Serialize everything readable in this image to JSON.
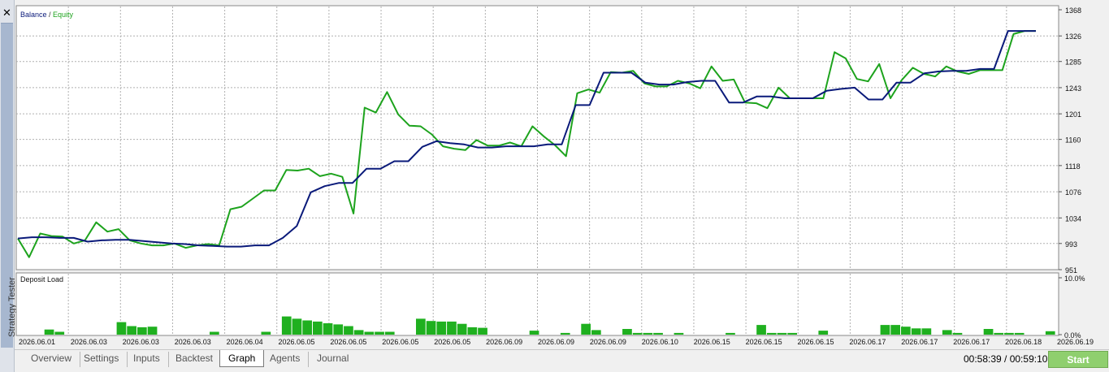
{
  "side_panel": {
    "label": "Strategy Tester",
    "close_glyph": "✕"
  },
  "legend": {
    "balance": "Balance",
    "separator": " / ",
    "equity": "Equity"
  },
  "deposit_label": "Deposit Load",
  "colors": {
    "balance": "#0a1a7a",
    "equity": "#1da31d",
    "bars": "#1fb01f",
    "grid": "#b0b0b0"
  },
  "chart_data": [
    {
      "type": "line",
      "series": [
        {
          "name": "Balance",
          "values": [
            1001,
            1003,
            1003,
            1002,
            1002,
            996,
            998,
            999,
            999,
            997,
            995,
            993,
            992,
            990,
            989,
            988,
            988,
            990,
            990,
            1002,
            1021,
            1075,
            1085,
            1090,
            1090,
            1113,
            1113,
            1125,
            1125,
            1148,
            1157,
            1154,
            1152,
            1147,
            1147,
            1149,
            1149,
            1149,
            1152,
            1152,
            1215,
            1215,
            1267,
            1267,
            1267,
            1251,
            1248,
            1248,
            1252,
            1254,
            1254,
            1219,
            1219,
            1229,
            1229,
            1226,
            1226,
            1226,
            1238,
            1241,
            1243,
            1224,
            1224,
            1251,
            1251,
            1266,
            1269,
            1270,
            1270,
            1273,
            1273,
            1334,
            1334,
            1334
          ]
        },
        {
          "name": "Equity",
          "values": [
            1001,
            971,
            1009,
            1005,
            1004,
            993,
            998,
            1027,
            1012,
            1016,
            998,
            993,
            990,
            990,
            993,
            986,
            990,
            992,
            990,
            1048,
            1052,
            1065,
            1078,
            1078,
            1111,
            1110,
            1113,
            1101,
            1105,
            1100,
            1041,
            1211,
            1203,
            1236,
            1200,
            1182,
            1181,
            1168,
            1149,
            1145,
            1143,
            1159,
            1150,
            1150,
            1155,
            1149,
            1181,
            1165,
            1151,
            1133,
            1234,
            1240,
            1235,
            1268,
            1267,
            1270,
            1250,
            1245,
            1245,
            1254,
            1250,
            1242,
            1277,
            1254,
            1256,
            1219,
            1218,
            1210,
            1243,
            1226,
            1226,
            1226,
            1226,
            1300,
            1290,
            1257,
            1253,
            1281,
            1226,
            1255,
            1275,
            1265,
            1261,
            1277,
            1269,
            1265,
            1271,
            1271,
            1271,
            1329,
            1334,
            1334
          ]
        }
      ],
      "ylim": [
        951,
        1368
      ],
      "y_ticks": [
        "1368",
        "1326",
        "1285",
        "1243",
        "1201",
        "1160",
        "1118",
        "1076",
        "1034",
        "993",
        "951"
      ]
    },
    {
      "type": "bar",
      "title": "Deposit Load",
      "ylim": [
        0,
        10
      ],
      "y_ticks": [
        "10.0%",
        "0.0%"
      ],
      "bars": [
        {
          "slot": 2,
          "v": 0.9
        },
        {
          "slot": 3,
          "v": 0.5
        },
        {
          "slot": 9,
          "v": 2.2
        },
        {
          "slot": 10,
          "v": 1.5
        },
        {
          "slot": 11,
          "v": 1.3
        },
        {
          "slot": 12,
          "v": 1.4
        },
        {
          "slot": 18,
          "v": 0.5
        },
        {
          "slot": 23,
          "v": 0.5
        },
        {
          "slot": 25,
          "v": 3.2
        },
        {
          "slot": 26,
          "v": 2.8
        },
        {
          "slot": 27,
          "v": 2.5
        },
        {
          "slot": 28,
          "v": 2.3
        },
        {
          "slot": 29,
          "v": 2.0
        },
        {
          "slot": 30,
          "v": 1.8
        },
        {
          "slot": 31,
          "v": 1.5
        },
        {
          "slot": 32,
          "v": 0.8
        },
        {
          "slot": 33,
          "v": 0.5
        },
        {
          "slot": 34,
          "v": 0.5
        },
        {
          "slot": 35,
          "v": 0.5
        },
        {
          "slot": 38,
          "v": 2.8
        },
        {
          "slot": 39,
          "v": 2.4
        },
        {
          "slot": 40,
          "v": 2.3
        },
        {
          "slot": 41,
          "v": 2.3
        },
        {
          "slot": 42,
          "v": 1.9
        },
        {
          "slot": 43,
          "v": 1.3
        },
        {
          "slot": 44,
          "v": 1.2
        },
        {
          "slot": 49,
          "v": 0.7
        },
        {
          "slot": 52,
          "v": 0.3
        },
        {
          "slot": 54,
          "v": 1.9
        },
        {
          "slot": 55,
          "v": 0.8
        },
        {
          "slot": 58,
          "v": 1.0
        },
        {
          "slot": 59,
          "v": 0.3
        },
        {
          "slot": 60,
          "v": 0.3
        },
        {
          "slot": 61,
          "v": 0.3
        },
        {
          "slot": 63,
          "v": 0.3
        },
        {
          "slot": 68,
          "v": 0.3
        },
        {
          "slot": 71,
          "v": 1.7
        },
        {
          "slot": 72,
          "v": 0.3
        },
        {
          "slot": 73,
          "v": 0.3
        },
        {
          "slot": 74,
          "v": 0.3
        },
        {
          "slot": 77,
          "v": 0.7
        },
        {
          "slot": 83,
          "v": 1.7
        },
        {
          "slot": 84,
          "v": 1.7
        },
        {
          "slot": 85,
          "v": 1.4
        },
        {
          "slot": 86,
          "v": 1.1
        },
        {
          "slot": 87,
          "v": 1.1
        },
        {
          "slot": 89,
          "v": 0.8
        },
        {
          "slot": 90,
          "v": 0.3
        },
        {
          "slot": 93,
          "v": 1.0
        },
        {
          "slot": 94,
          "v": 0.3
        },
        {
          "slot": 95,
          "v": 0.3
        },
        {
          "slot": 96,
          "v": 0.3
        },
        {
          "slot": 99,
          "v": 0.6
        }
      ]
    }
  ],
  "x_labels": [
    "2026.06.01",
    "2026.06.03",
    "2026.06.03",
    "2026.06.03",
    "2026.06.04",
    "2026.06.05",
    "2026.06.05",
    "2026.06.05",
    "2026.06.05",
    "2026.06.09",
    "2026.06.09",
    "2026.06.09",
    "2026.06.10",
    "2026.06.15",
    "2026.06.15",
    "2026.06.15",
    "2026.06.17",
    "2026.06.17",
    "2026.06.17",
    "2026.06.18",
    "2026.06.19"
  ],
  "tabs": [
    {
      "label": "Overview"
    },
    {
      "label": "Settings"
    },
    {
      "label": "Inputs"
    },
    {
      "label": "Backtest"
    },
    {
      "label": "Graph"
    },
    {
      "label": "Agents"
    },
    {
      "label": "Journal"
    }
  ],
  "active_tab": "Graph",
  "timer": "00:58:39 / 00:59:10",
  "start_label": "Start"
}
